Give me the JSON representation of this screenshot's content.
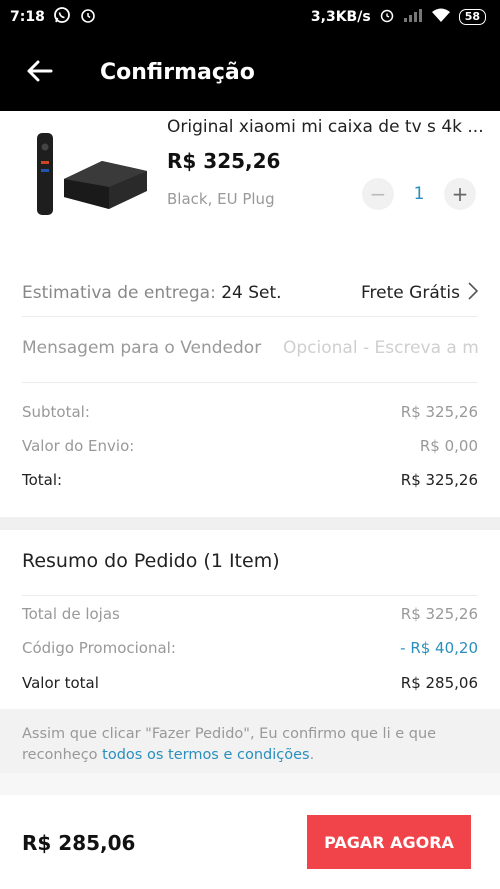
{
  "status_bar": {
    "time": "7:18",
    "network_speed": "3,3KB/s",
    "battery": "58"
  },
  "header": {
    "title": "Confirmação",
    "back_icon": "arrow-left-icon"
  },
  "product": {
    "title": "Original xiaomi mi caixa de tv s 4k ...",
    "price": "R$ 325,26",
    "variant": "Black, EU Plug",
    "quantity": "1"
  },
  "delivery": {
    "label": "Estimativa de entrega:",
    "date": "24 Set.",
    "shipping": "Frete Grátis"
  },
  "message": {
    "label": "Mensagem para o Vendedor",
    "placeholder": "Opcional - Escreva a m"
  },
  "summary": {
    "subtotal_label": "Subtotal:",
    "subtotal_value": "R$ 325,26",
    "shipping_label": "Valor do Envio:",
    "shipping_value": "R$ 0,00",
    "total_label": "Total:",
    "total_value": "R$ 325,26"
  },
  "order_summary": {
    "title": "Resumo do Pedido (1 Item)",
    "stores_label": "Total de lojas",
    "stores_value": "R$ 325,26",
    "promo_label": "Código Promocional:",
    "promo_value": "- R$ 40,20",
    "grand_label": "Valor total",
    "grand_value": "R$ 285,06"
  },
  "terms": {
    "text": "Assim que clicar \"Fazer Pedido\", Eu confirmo que li e que reconheço",
    "link": "todos os termos e condições",
    "end": "."
  },
  "footer": {
    "total": "R$ 285,06",
    "pay_button": "PAGAR AGORA"
  },
  "colors": {
    "accent": "#2a8fbd",
    "pay_button": "#f0444a",
    "header_bg": "#000000"
  }
}
